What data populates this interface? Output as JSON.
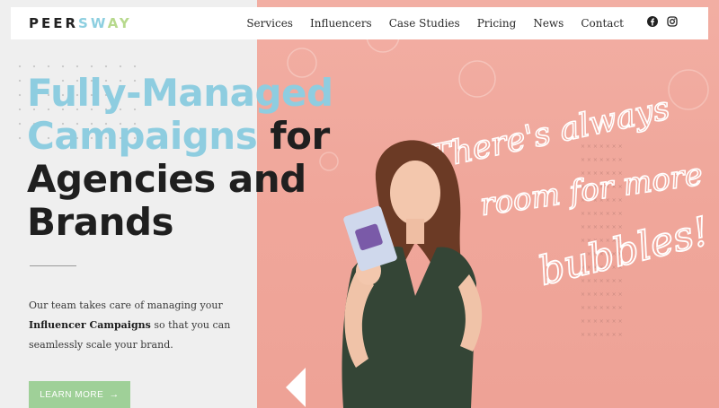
{
  "brand": {
    "part1": "PEER",
    "part2": "SW",
    "part3": "AY"
  },
  "nav": {
    "items": [
      "Services",
      "Influencers",
      "Case Studies",
      "Pricing",
      "News",
      "Contact"
    ]
  },
  "social": {
    "icons": [
      "facebook-icon",
      "instagram-icon"
    ]
  },
  "hero": {
    "headline_blue_1": "Fully-Managed",
    "headline_blue_2": "Campaigns",
    "headline_dark_1": " for",
    "headline_dark_2": "Agencies and",
    "headline_dark_3": "Brands",
    "desc_1": "Our team takes care of managing your ",
    "desc_bold": "Influencer Campaigns",
    "desc_2": " so that you can seamlessly scale your brand.",
    "cta_label": "LEARN MORE",
    "cta_arrow": "→"
  },
  "neon": {
    "line1": "There's always",
    "line2": "room for more",
    "line3": "bubbles!"
  },
  "colors": {
    "accent_blue": "#8ecde0",
    "accent_green": "#9fd098",
    "photo_pink": "#f0a79b"
  }
}
